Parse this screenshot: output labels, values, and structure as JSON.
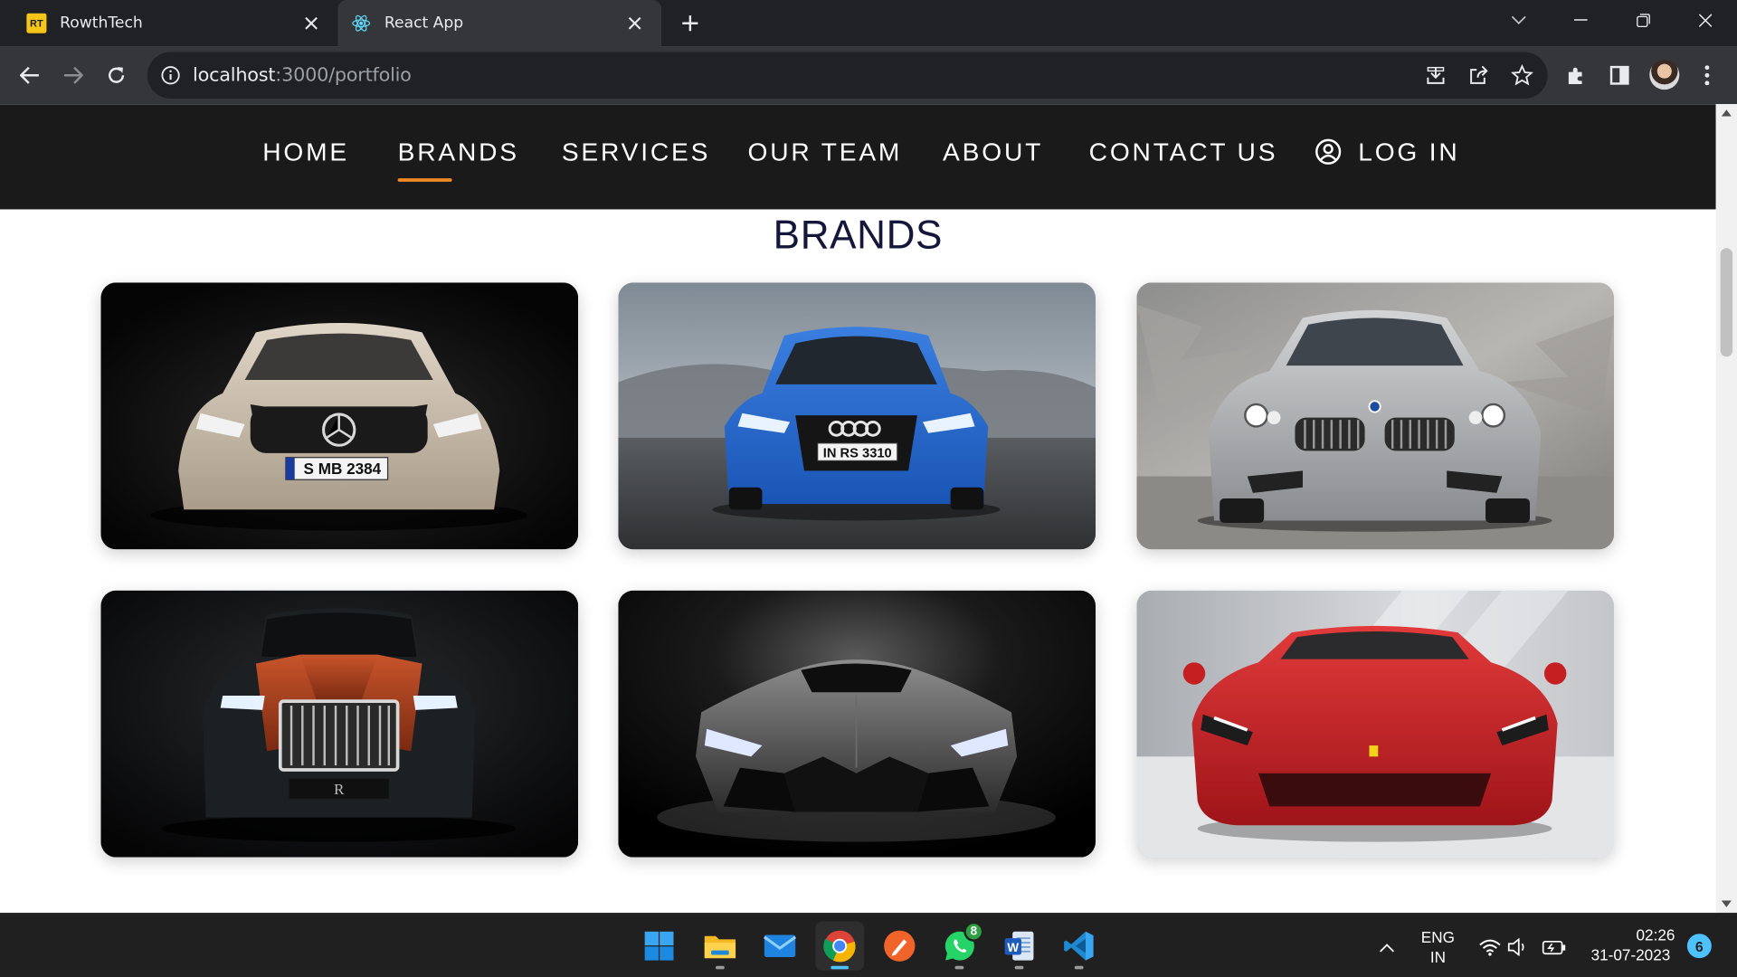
{
  "browser": {
    "tabs": [
      {
        "title": "RowthTech",
        "favicon": "rowthtech-logo",
        "favicon_text": "RT",
        "active": false
      },
      {
        "title": "React App",
        "favicon": "react-icon",
        "active": true
      }
    ],
    "address": {
      "host": "localhost",
      "path": ":3000/portfolio"
    }
  },
  "site": {
    "nav": [
      {
        "label": "HOME",
        "active": false
      },
      {
        "label": "BRANDS",
        "active": true
      },
      {
        "label": "SERVICES",
        "active": false
      },
      {
        "label": "OUR TEAM",
        "active": false
      },
      {
        "label": "ABOUT",
        "active": false
      },
      {
        "label": "CONTACT US",
        "active": false
      }
    ],
    "login_label": "LOG IN",
    "accent_color": "#f08a24",
    "section_title": "BRANDS",
    "brand_cards": [
      {
        "name": "mercedes-card",
        "plate": "S MB 2384"
      },
      {
        "name": "audi-card",
        "plate": "IN RS 3310"
      },
      {
        "name": "bmw-card"
      },
      {
        "name": "rolls-royce-card"
      },
      {
        "name": "lamborghini-card"
      },
      {
        "name": "ferrari-card"
      }
    ]
  },
  "taskbar": {
    "apps": [
      "windows-start-icon",
      "file-explorer-icon",
      "mail-icon",
      "chrome-icon",
      "pen-app-icon",
      "whatsapp-icon",
      "word-icon",
      "vscode-icon"
    ],
    "whatsapp_badge": "8",
    "language_line1": "ENG",
    "language_line2": "IN",
    "time": "02:26",
    "date": "31-07-2023",
    "notification_count": "6"
  }
}
